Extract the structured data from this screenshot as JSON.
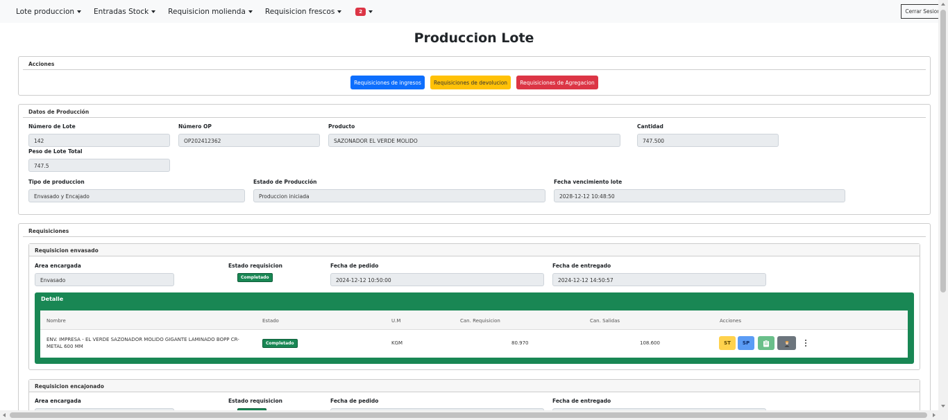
{
  "navbar": {
    "items": [
      {
        "label": "Lote produccion"
      },
      {
        "label": "Entradas Stock"
      },
      {
        "label": "Requisicion molienda"
      },
      {
        "label": "Requisicion frescos"
      }
    ],
    "notification_count": "2",
    "logout_label": "Cerrar Sesion"
  },
  "page": {
    "title": "Produccion Lote"
  },
  "acciones": {
    "title": "Acciones",
    "buttons": [
      {
        "label": "Requisiciones de ingresos",
        "color": "#0d6efd"
      },
      {
        "label": "Requisiciones de devolucion",
        "color": "#ffc107"
      },
      {
        "label": "Requisiciones de Agregacion",
        "color": "#dc3545"
      }
    ]
  },
  "datos": {
    "title": "Datos de Producción",
    "numero_lote": {
      "label": "Número de Lote",
      "value": "142"
    },
    "numero_op": {
      "label": "Número OP",
      "value": "OP202412362"
    },
    "producto": {
      "label": "Producto",
      "value": "SAZONADOR EL VERDE MOLIDO"
    },
    "cantidad": {
      "label": "Cantidad",
      "value": "747.500"
    },
    "peso_total": {
      "label": "Peso de Lote Total",
      "value": "747.5"
    },
    "tipo_produccion": {
      "label": "Tipo de produccion",
      "value": "Envasado y Encajado"
    },
    "estado_produccion": {
      "label": "Estado de Producción",
      "value": "Produccion iniciada"
    },
    "fecha_vencimiento": {
      "label": "Fecha vencimiento lote",
      "value": "2028-12-12 10:48:50"
    }
  },
  "requisiciones": {
    "title": "Requisiciones",
    "envasado": {
      "title": "Requisicion envasado",
      "area_label": "Area encargada",
      "area_value": "Envasado",
      "estado_label": "Estado requisicion",
      "estado_value": "Completado",
      "fecha_pedido_label": "Fecha de pedido",
      "fecha_pedido_value": "2024-12-12 10:50:00",
      "fecha_entregado_label": "Fecha de entregado",
      "fecha_entregado_value": "2024-12-12 14:50:57",
      "detalle": {
        "title": "Detalle",
        "columns": [
          "Nombre",
          "Estado",
          "U.M",
          "Can. Requisicion",
          "Can. Salidas",
          "Acciones"
        ],
        "rows": [
          {
            "nombre": "ENV. IMPRESA - EL VERDE SAZONADOR MOLIDO GIGANTE LAMINADO BOPP CR-METAL 600 MM",
            "estado": "Completado",
            "um": "KGM",
            "can_requisicion": "80.970",
            "can_salidas": "108.600",
            "actions": [
              {
                "label": "ST",
                "color": "#ffd24d",
                "icon": "st-text"
              },
              {
                "label": "SP",
                "color": "#5b9cf5",
                "icon": "sp-text"
              },
              {
                "label": "",
                "color": "#6abf8a",
                "icon": "clipboard-icon"
              },
              {
                "label": "",
                "color": "#6c757d",
                "icon": "worker-icon"
              }
            ]
          }
        ]
      }
    },
    "encajonado": {
      "title": "Requisicion encajonado",
      "area_label": "Area encargada",
      "estado_label": "Estado requisicion",
      "fecha_pedido_label": "Fecha de pedido",
      "fecha_entregado_label": "Fecha de entregado"
    }
  }
}
